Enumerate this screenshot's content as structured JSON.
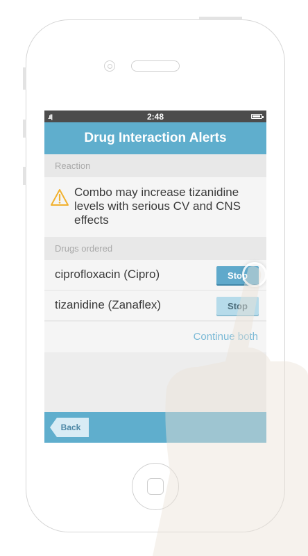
{
  "status_bar": {
    "time": "2:48",
    "signal": ".ıl|"
  },
  "nav": {
    "title": "Drug Interaction Alerts"
  },
  "reaction": {
    "header": "Reaction",
    "icon": "warning-triangle-icon",
    "text": "Combo may increase tizanidine levels with serious CV and CNS effects"
  },
  "drugs": {
    "header": "Drugs ordered",
    "items": [
      {
        "name": "ciprofloxacin (Cipro)",
        "action": "Stop"
      },
      {
        "name": "tizanidine (Zanaflex)",
        "action": "Stop"
      }
    ],
    "continue_label": "Continue both"
  },
  "toolbar": {
    "back_label": "Back"
  },
  "colors": {
    "accent": "#5faecd",
    "warning": "#f1b12f"
  }
}
